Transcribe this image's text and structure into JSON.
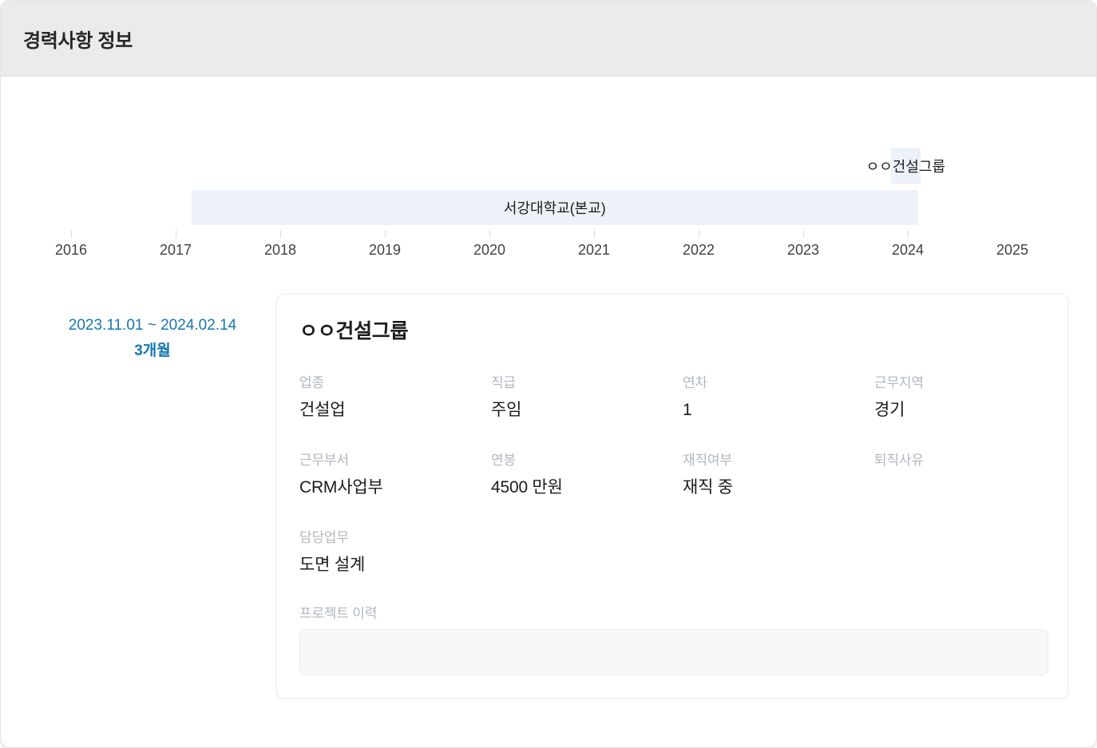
{
  "header": {
    "title": "경력사항 정보"
  },
  "accent_color": "#1577b2",
  "chart_data": {
    "type": "timeline",
    "x_axis": {
      "range": [
        2016,
        2025
      ],
      "years": [
        {
          "label": "2016",
          "tick": true
        },
        {
          "label": "2017",
          "tick": true
        },
        {
          "label": "2018",
          "tick": true
        },
        {
          "label": "2019",
          "tick": true
        },
        {
          "label": "2020",
          "tick": true
        },
        {
          "label": "2021",
          "tick": true
        },
        {
          "label": "2022",
          "tick": true
        },
        {
          "label": "2023",
          "tick": true
        },
        {
          "label": "2024",
          "tick": true
        },
        {
          "label": "2025",
          "tick": false
        }
      ]
    },
    "bars": [
      {
        "label": "ㅇㅇ건설그룹",
        "start_year": 2023.84,
        "end_year": 2024.12,
        "row": 0
      },
      {
        "label": "서강대학교(본교)",
        "start_year": 2017.15,
        "end_year": 2024.1,
        "row": 1
      }
    ],
    "bar_color": "#edf1f9",
    "grid": false,
    "legend": false
  },
  "period": {
    "range": "2023.11.01 ~ 2024.02.14",
    "duration": "3개월"
  },
  "career_card": {
    "title": "ㅇㅇ건설그룹",
    "fields": [
      {
        "label": "업종",
        "value": "건설업"
      },
      {
        "label": "직급",
        "value": "주임"
      },
      {
        "label": "연차",
        "value": "1"
      },
      {
        "label": "근무지역",
        "value": "경기"
      },
      {
        "label": "근무부서",
        "value": "CRM사업부"
      },
      {
        "label": "연봉",
        "value": "4500 만원"
      },
      {
        "label": "재직여부",
        "value": "재직 중"
      },
      {
        "label": "퇴직사유",
        "value": ""
      },
      {
        "label": "담당업무",
        "value": "도면 설계"
      }
    ],
    "project_history": {
      "label": "프로젝트 이력",
      "value": ""
    }
  }
}
